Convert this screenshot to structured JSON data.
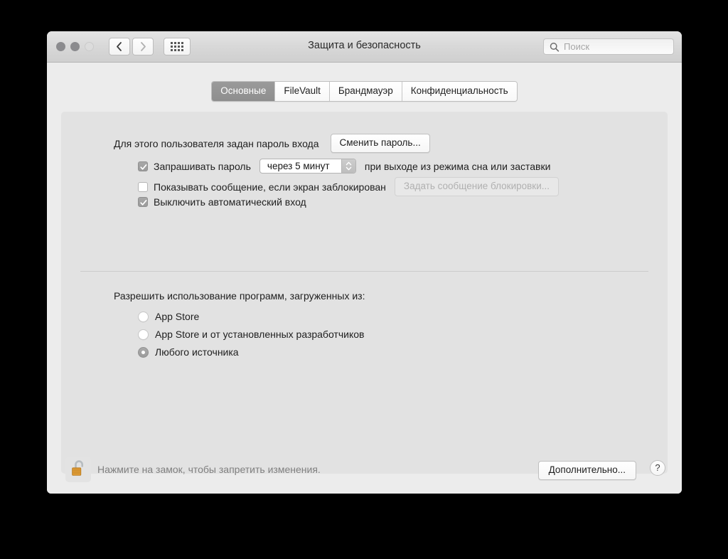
{
  "window": {
    "title": "Защита и безопасность",
    "traffic_lights": [
      "close",
      "minimize",
      "zoom"
    ],
    "nav": {
      "back_icon": "chevron-left-icon",
      "forward_icon": "chevron-right-icon",
      "grid_icon": "grid-dots-icon"
    }
  },
  "search": {
    "placeholder": "Поиск",
    "value": "",
    "icon": "search-icon"
  },
  "tabs": [
    {
      "label": "Основные",
      "active": true
    },
    {
      "label": "FileVault",
      "active": false
    },
    {
      "label": "Брандмауэр",
      "active": false
    },
    {
      "label": "Конфиденциальность",
      "active": false
    }
  ],
  "general": {
    "password_label": "Для этого пользователя задан пароль входа",
    "change_password_button": "Сменить пароль...",
    "require_password": {
      "checked": true,
      "label_before": "Запрашивать пароль",
      "interval_value": "через 5 минут",
      "label_after": "при выходе из режима сна или заставки"
    },
    "show_message": {
      "checked": false,
      "label": "Показывать сообщение, если экран заблокирован",
      "button": "Задать сообщение блокировки...",
      "button_disabled": true
    },
    "disable_auto_login": {
      "checked": true,
      "label": "Выключить автоматический вход"
    }
  },
  "gatekeeper": {
    "heading": "Разрешить использование программ, загруженных из:",
    "options": [
      {
        "label": "App Store",
        "selected": false
      },
      {
        "label": "App Store и от установленных разработчиков",
        "selected": false
      },
      {
        "label": "Любого источника",
        "selected": true
      }
    ]
  },
  "footer": {
    "lock_icon": "unlocked-padlock-icon",
    "lock_text": "Нажмите на замок, чтобы запретить изменения.",
    "advanced_button": "Дополнительно...",
    "help_button": "?"
  },
  "colors": {
    "window_bg": "#ececec",
    "panel_bg": "#e2e2e2",
    "titlebar_bg": "#d8d8d8",
    "active_tab_bg": "#949494",
    "text": "#1e1e1e",
    "muted_text": "#808080",
    "lock_gold": "#e8a33d"
  }
}
